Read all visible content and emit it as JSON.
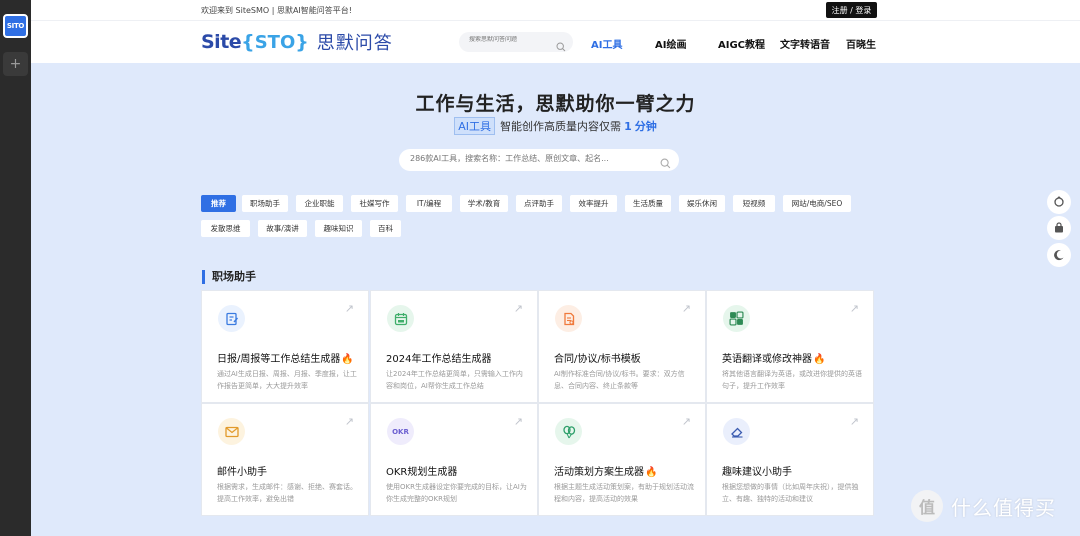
{
  "rail": {
    "active_label": "SITO",
    "add_label": "+"
  },
  "topbar": {
    "welcome": "欢迎来到 SiteSMO | 思默AI智能问答平台!",
    "login": "注册 / 登录"
  },
  "navbar": {
    "logo_site": "Site",
    "logo_brace_open": "{",
    "logo_sto": "STO",
    "logo_brace_close": "}",
    "logo_cn": "思默问答",
    "search_placeholder": "搜索思默问答问题",
    "links": [
      "AI工具",
      "AI绘画",
      "AIGC教程",
      "文字转语音",
      "百晓生"
    ]
  },
  "hero": {
    "title": "工作与生活，思默助你一臂之力",
    "tag": "AI工具",
    "sub_text": "智能创作高质量内容仅需",
    "sub_num": "1",
    "sub_unit": "分钟",
    "search_placeholder": "286款AI工具，搜索名称：工作总结、原创文章、起名..."
  },
  "categories": [
    "推荐",
    "职场助手",
    "企业职能",
    "社媒写作",
    "IT/编程",
    "学术/教育",
    "点评助手",
    "效率提升",
    "生活质量",
    "娱乐休闲",
    "短视频",
    "网站/电商/SEO",
    "发散思维",
    "故事/演讲",
    "趣味知识",
    "百科"
  ],
  "section": {
    "title": "职场助手"
  },
  "cards": [
    {
      "title": "日报/周报等工作总结生成器",
      "fire": true,
      "desc": "通过AI生成日报、周报、月报、季度报，让工作报告更简单，大大提升效率",
      "icon": "edit-doc-icon",
      "color": "#3a7be0",
      "bg": "#eaf2fe"
    },
    {
      "title": "2024年工作总结生成器",
      "fire": false,
      "desc": "让2024年工作总结更简单，只需输入工作内容和岗位，AI帮你生成工作总结",
      "icon": "calendar-icon",
      "color": "#3fae6a",
      "bg": "#e6f6ec"
    },
    {
      "title": "合同/协议/标书模板",
      "fire": false,
      "desc": "AI制作标准合同/协议/标书。要求：双方信息、合同内容、终止条款等",
      "icon": "contract-doc-icon",
      "color": "#f07a3c",
      "bg": "#fdeee4"
    },
    {
      "title": "英语翻译或修改神器",
      "fire": true,
      "desc": "将其他语言翻译为英语，或改进你提供的英语句子，提升工作效率",
      "icon": "translate-icon",
      "color": "#2e8b55",
      "bg": "#e6f6ec"
    },
    {
      "title": "邮件小助手",
      "fire": false,
      "desc": "根据需求，生成邮件：感谢、拒绝、赛套话。提高工作效率，避免出错",
      "icon": "mail-icon",
      "color": "#e29a2a",
      "bg": "#fdf3df"
    },
    {
      "title": "OKR规划生成器",
      "fire": false,
      "desc": "使用OKR生成器设定你要完成的目标，让AI为你生成完整的OKR规划",
      "icon": "okr-icon",
      "color": "#6b5fd0",
      "bg": "#efecfc",
      "icon_text": "OKR"
    },
    {
      "title": "活动策划方案生成器",
      "fire": true,
      "desc": "根据主题生成活动策划案，有助于规划活动流程和内容，提高活动的效果",
      "icon": "balloon-icon",
      "color": "#2e9f6a",
      "bg": "#e6f6ec"
    },
    {
      "title": "趣味建议小助手",
      "fire": false,
      "desc": "根据您想做的事情（比如周年庆祝），提供独立、有趣、独特的活动和建议",
      "icon": "eraser-icon",
      "color": "#3a5bb0",
      "bg": "#eaeffc"
    }
  ],
  "watermark": {
    "symbol": "值",
    "text": "什么值得买"
  }
}
